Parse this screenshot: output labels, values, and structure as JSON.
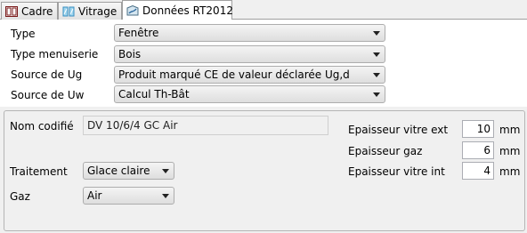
{
  "tabs": [
    {
      "label": "Cadre",
      "icon": "frame-icon"
    },
    {
      "label": "Vitrage",
      "icon": "glazing-icon"
    },
    {
      "label": "Données RT2012",
      "icon": "rt2012-icon"
    }
  ],
  "form": {
    "type": {
      "label": "Type",
      "value": "Fenêtre"
    },
    "menuiserie": {
      "label": "Type menuiserie",
      "value": "Bois"
    },
    "source_ug": {
      "label": "Source de Ug",
      "value": "Produit marqué CE de valeur déclarée Ug,d"
    },
    "source_uw": {
      "label": "Source de Uw",
      "value": "Calcul Th-Bât"
    }
  },
  "glazing": {
    "nom_label": "Nom codifié",
    "nom_value": "DV 10/6/4 GC Air",
    "traitement_label": "Traitement",
    "traitement_value": "Glace claire",
    "gaz_label": "Gaz",
    "gaz_value": "Air",
    "ep_ext_label": "Epaisseur vitre ext",
    "ep_ext_value": "10",
    "ep_gaz_label": "Epaisseur gaz",
    "ep_gaz_value": "6",
    "ep_int_label": "Epaisseur vitre int",
    "ep_int_value": "4",
    "unit": "mm"
  }
}
